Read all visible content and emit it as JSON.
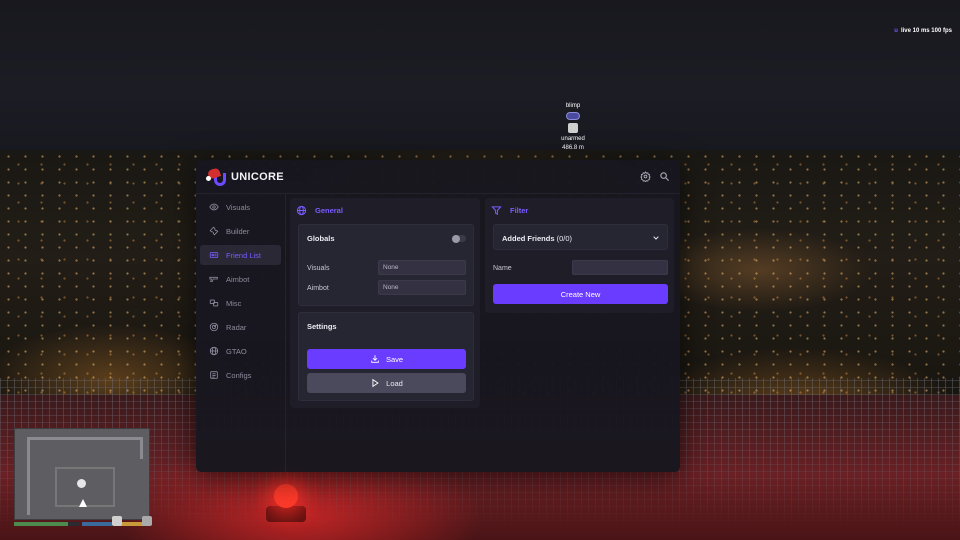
{
  "hud": {
    "fps_prefix": "u",
    "fps_text": "live 10 ms 100 fps",
    "player_name": "blimp",
    "player_weapon": "unarmed",
    "player_distance": "486.8 m",
    "health_fraction": 0.82,
    "armor_fraction": 0.9,
    "stamina_fraction": 0.85
  },
  "menu": {
    "brand": "UNICORE",
    "accent_color": "#6a3cff",
    "sidebar": [
      {
        "label": "Visuals",
        "icon": "eye-icon"
      },
      {
        "label": "Builder",
        "icon": "wrench-icon"
      },
      {
        "label": "Friend List",
        "icon": "friends-icon",
        "active": true
      },
      {
        "label": "Aimbot",
        "icon": "gun-icon"
      },
      {
        "label": "Misc",
        "icon": "misc-icon"
      },
      {
        "label": "Radar",
        "icon": "radar-icon"
      },
      {
        "label": "GTAO",
        "icon": "globe-icon"
      },
      {
        "label": "Configs",
        "icon": "configs-icon"
      }
    ],
    "general": {
      "title": "General",
      "globals": {
        "title": "Globals",
        "toggle_on": false,
        "visuals_label": "Visuals",
        "visuals_value": "None",
        "aimbot_label": "Aimbot",
        "aimbot_value": "None"
      },
      "settings": {
        "title": "Settings",
        "save_label": "Save",
        "load_label": "Load"
      }
    },
    "filter": {
      "title": "Filter",
      "dropdown_label": "Added Friends",
      "dropdown_count": "(0/0)",
      "name_label": "Name",
      "name_value": "",
      "create_label": "Create New"
    }
  }
}
